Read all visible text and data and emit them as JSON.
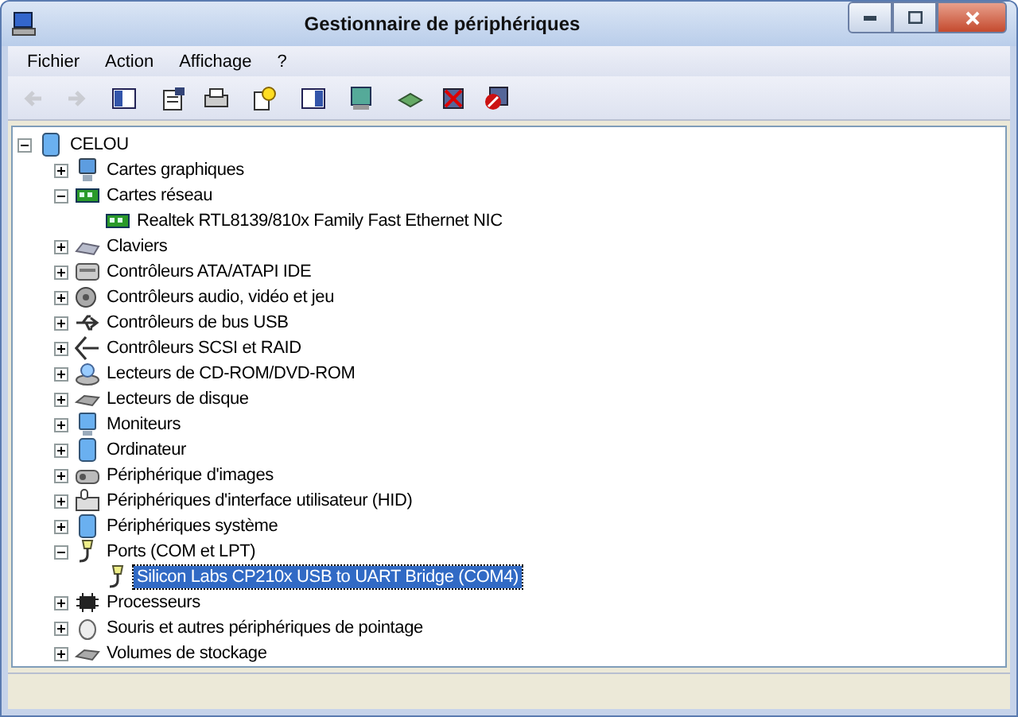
{
  "window": {
    "title": "Gestionnaire de périphériques"
  },
  "menu": [
    "Fichier",
    "Action",
    "Affichage",
    "?"
  ],
  "toolbar": [
    {
      "kind": "back",
      "disabled": true
    },
    {
      "kind": "forward",
      "disabled": true
    },
    {
      "kind": "tree",
      "disabled": false
    },
    {
      "kind": "properties",
      "disabled": false
    },
    {
      "kind": "print",
      "disabled": false
    },
    {
      "kind": "help",
      "disabled": false
    },
    {
      "kind": "panel",
      "disabled": false
    },
    {
      "kind": "scan",
      "disabled": false
    },
    {
      "kind": "update",
      "disabled": false
    },
    {
      "kind": "uninstall",
      "disabled": false
    },
    {
      "kind": "disable",
      "disabled": false
    }
  ],
  "tree": {
    "label": "CELOU",
    "expanded": true,
    "selected": false,
    "children": [
      {
        "label": "Cartes graphiques",
        "expanded": false,
        "selected": false
      },
      {
        "label": "Cartes réseau",
        "expanded": true,
        "selected": false,
        "children": [
          {
            "label": "Realtek RTL8139/810x Family Fast Ethernet NIC",
            "selected": false
          }
        ]
      },
      {
        "label": "Claviers",
        "expanded": false,
        "selected": false
      },
      {
        "label": "Contrôleurs ATA/ATAPI IDE",
        "expanded": false,
        "selected": false
      },
      {
        "label": "Contrôleurs audio, vidéo et jeu",
        "expanded": false,
        "selected": false
      },
      {
        "label": "Contrôleurs de bus USB",
        "expanded": false,
        "selected": false
      },
      {
        "label": "Contrôleurs SCSI et RAID",
        "expanded": false,
        "selected": false
      },
      {
        "label": "Lecteurs de CD-ROM/DVD-ROM",
        "expanded": false,
        "selected": false
      },
      {
        "label": "Lecteurs de disque",
        "expanded": false,
        "selected": false
      },
      {
        "label": "Moniteurs",
        "expanded": false,
        "selected": false
      },
      {
        "label": "Ordinateur",
        "expanded": false,
        "selected": false
      },
      {
        "label": "Périphérique d'images",
        "expanded": false,
        "selected": false
      },
      {
        "label": "Périphériques d'interface utilisateur (HID)",
        "expanded": false,
        "selected": false
      },
      {
        "label": "Périphériques système",
        "expanded": false,
        "selected": false
      },
      {
        "label": "Ports (COM et LPT)",
        "expanded": true,
        "selected": false,
        "children": [
          {
            "label": "Silicon Labs CP210x USB to UART Bridge (COM4)",
            "selected": true
          }
        ]
      },
      {
        "label": "Processeurs",
        "expanded": false,
        "selected": false
      },
      {
        "label": "Souris et autres périphériques de pointage",
        "expanded": false,
        "selected": false
      },
      {
        "label": "Volumes de stockage",
        "expanded": false,
        "selected": false
      }
    ]
  }
}
